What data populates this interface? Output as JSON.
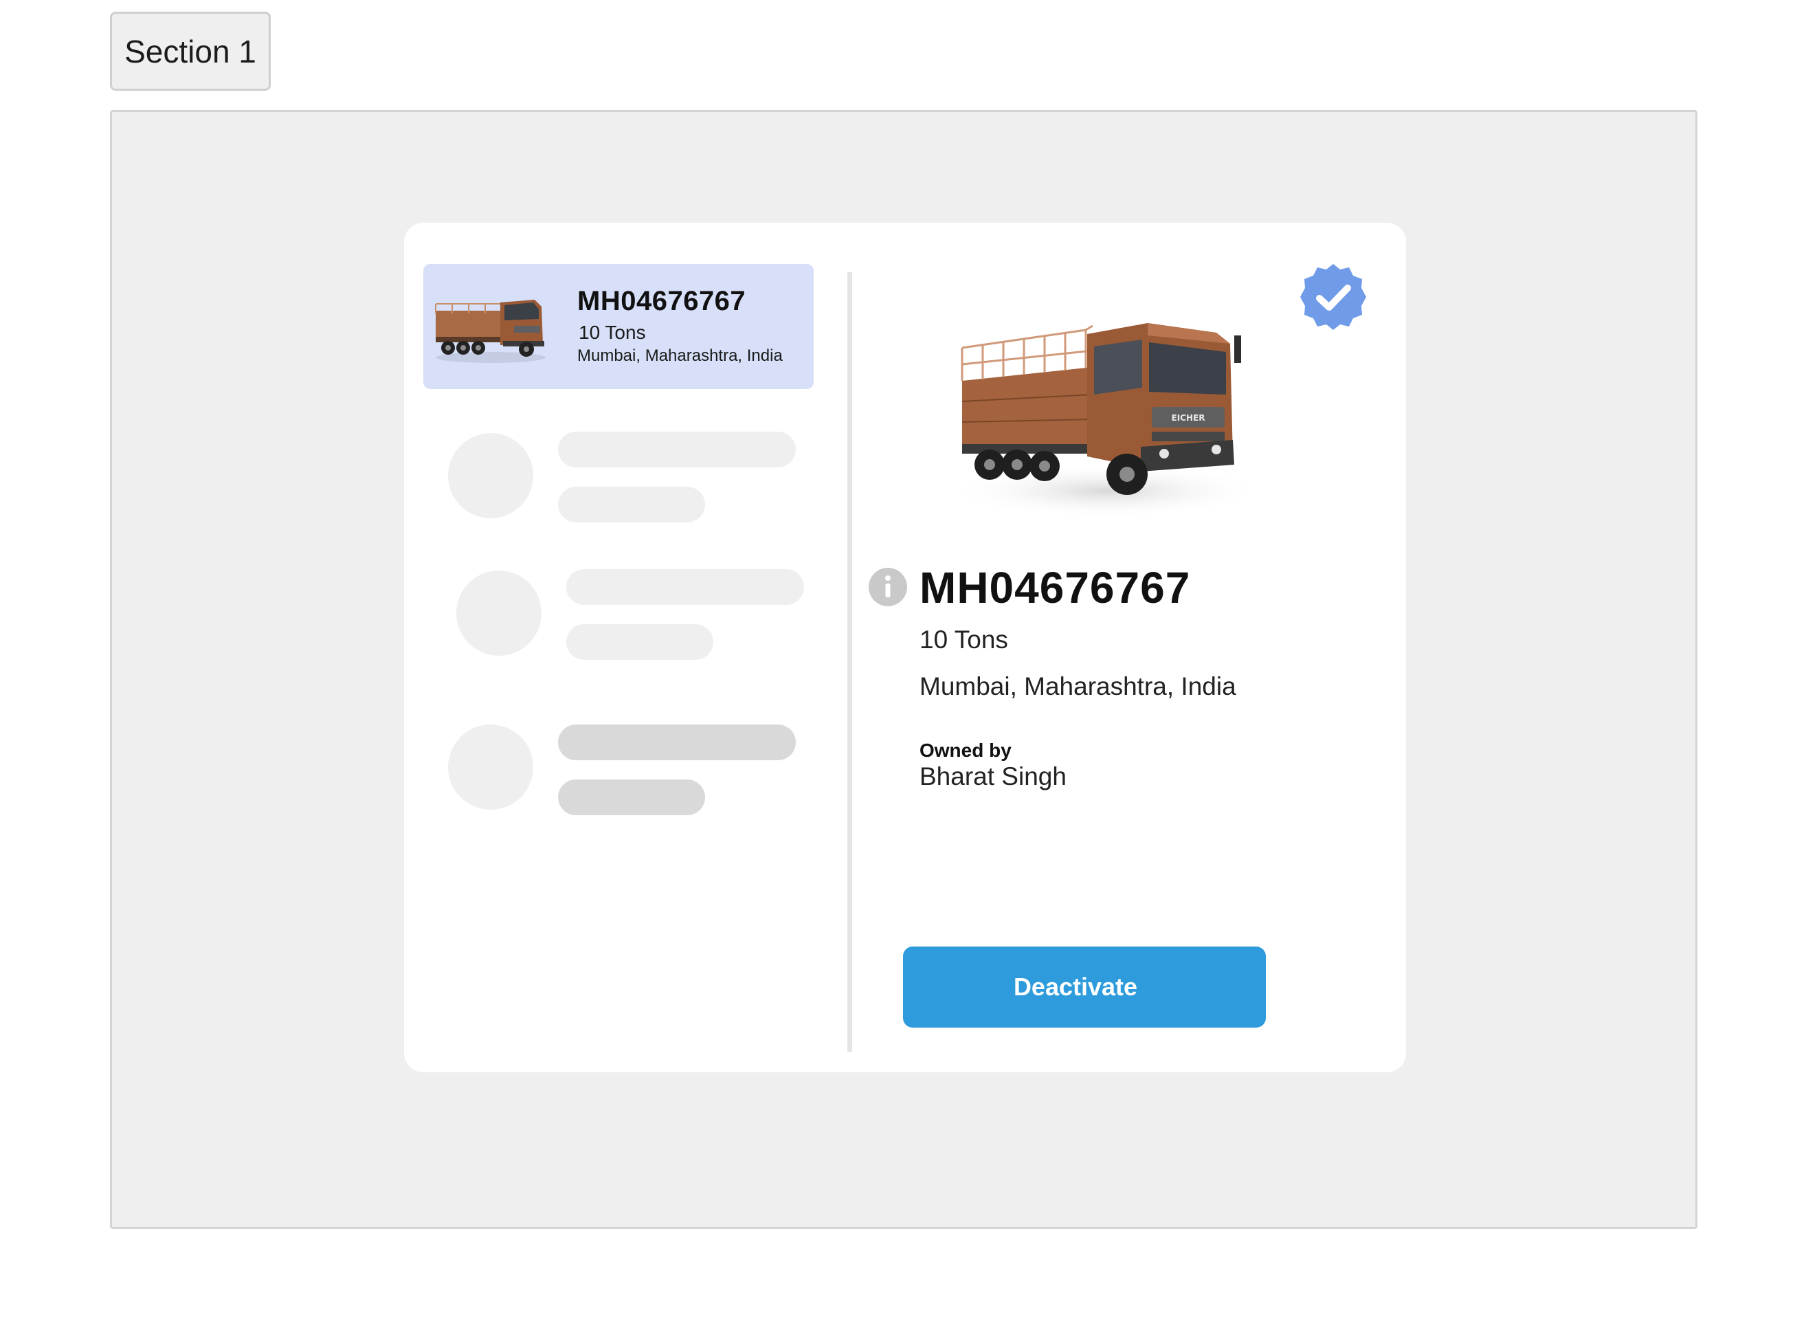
{
  "section_tab": {
    "label": "Section 1"
  },
  "vehicle_list": {
    "selected": {
      "registration": "MH04676767",
      "capacity": "10 Tons",
      "location": "Mumbai, Maharashtra, India"
    }
  },
  "details": {
    "registration": "MH04676767",
    "capacity": "10 Tons",
    "location": "Mumbai, Maharashtra, India",
    "owned_by_label": "Owned by",
    "owner": "Bharat Singh",
    "truck_brand": "EICHER",
    "deactivate_label": "Deactivate"
  },
  "icons": {
    "verified": "verified-badge-icon",
    "info": "info-icon"
  },
  "colors": {
    "selected_item_bg": "#d7e0f8",
    "button_bg": "#2e9cdc",
    "verified_badge": "#6f9be8",
    "truck_body": "#9a5a36"
  }
}
